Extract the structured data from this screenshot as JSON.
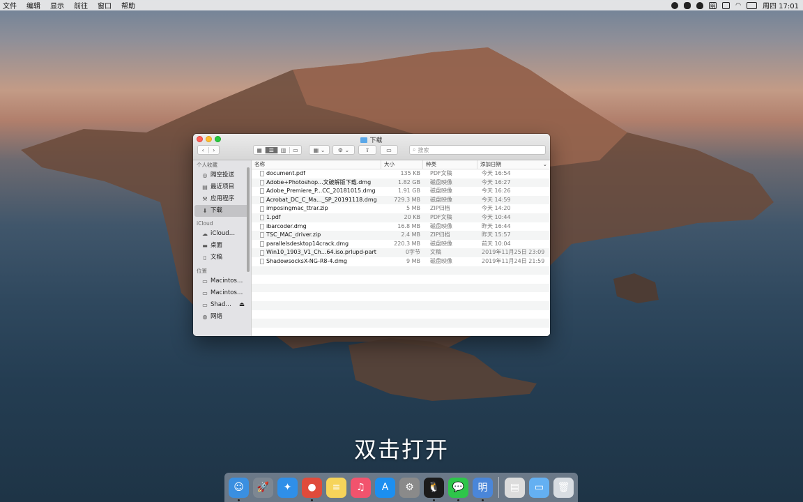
{
  "menubar": {
    "menus": [
      "文件",
      "编辑",
      "显示",
      "前往",
      "窗口",
      "帮助"
    ],
    "status_icons": [
      "record-icon",
      "wechat-icon",
      "qq-icon",
      "ming-icon",
      "keyboard-icon",
      "wifi-icon",
      "battery-icon"
    ],
    "ime_label": "明",
    "clock": "周四 17:01"
  },
  "window": {
    "title": "下载",
    "search_placeholder": "搜索"
  },
  "sidebar": {
    "sections": [
      {
        "header": "个人收藏",
        "items": [
          {
            "label": "隔空投送",
            "icon": "airdrop-icon"
          },
          {
            "label": "最近项目",
            "icon": "recents-icon"
          },
          {
            "label": "应用程序",
            "icon": "applications-icon"
          },
          {
            "label": "下载",
            "icon": "downloads-icon",
            "active": true
          }
        ]
      },
      {
        "header": "iCloud",
        "items": [
          {
            "label": "iCloud…",
            "icon": "cloud-icon"
          },
          {
            "label": "桌面",
            "icon": "desktop-icon"
          },
          {
            "label": "文稿",
            "icon": "documents-icon"
          }
        ]
      },
      {
        "header": "位置",
        "items": [
          {
            "label": "Macintos…",
            "icon": "disk-icon"
          },
          {
            "label": "Macintos…",
            "icon": "disk-icon"
          },
          {
            "label": "Shad…",
            "icon": "disk-icon",
            "eject": "⏏"
          },
          {
            "label": "网络",
            "icon": "network-icon"
          }
        ]
      }
    ]
  },
  "columns": {
    "name": "名称",
    "size": "大小",
    "kind": "种类",
    "date": "添加日期"
  },
  "files": [
    {
      "name": "document.pdf",
      "size": "135 KB",
      "kind": "PDF文稿",
      "date": "今天 16:54"
    },
    {
      "name": "Adobe+Photoshop...文破解版下载.dmg",
      "size": "1.82 GB",
      "kind": "磁盘映像",
      "date": "今天 16:27"
    },
    {
      "name": "Adobe_Premiere_P...CC_20181015.dmg",
      "size": "1.91 GB",
      "kind": "磁盘映像",
      "date": "今天 16:26"
    },
    {
      "name": "Acrobat_DC_C_Ma..._SP_20191118.dmg",
      "size": "729.3 MB",
      "kind": "磁盘映像",
      "date": "今天 14:59"
    },
    {
      "name": "imposingmac_ttrar.zip",
      "size": "5 MB",
      "kind": "ZIP归档",
      "date": "今天 14:20"
    },
    {
      "name": "1.pdf",
      "size": "20 KB",
      "kind": "PDF文稿",
      "date": "今天 10:44"
    },
    {
      "name": "ibarcoder.dmg",
      "size": "16.8 MB",
      "kind": "磁盘映像",
      "date": "昨天 16:44"
    },
    {
      "name": "TSC_MAC_driver.zip",
      "size": "2.4 MB",
      "kind": "ZIP归档",
      "date": "昨天 15:57"
    },
    {
      "name": "parallelsdesktop14crack.dmg",
      "size": "220.3 MB",
      "kind": "磁盘映像",
      "date": "前天 10:04"
    },
    {
      "name": "Win10_1903_V1_Ch...64.iso.prlupd-part",
      "size": "0字节",
      "kind": "文稿",
      "date": "2019年11月25日 23:09"
    },
    {
      "name": "ShadowsocksX-NG-R8-4.dmg",
      "size": "9 MB",
      "kind": "磁盘映像",
      "date": "2019年11月24日 21:59"
    }
  ],
  "subtitle": "双击打开",
  "dock": {
    "apps": [
      {
        "name": "finder",
        "color": "#3a8fe0",
        "glyph": "☺",
        "running": true
      },
      {
        "name": "launchpad",
        "color": "#7d8792",
        "glyph": "🚀",
        "running": false
      },
      {
        "name": "safari",
        "color": "#2f8fe8",
        "glyph": "✦",
        "running": false
      },
      {
        "name": "chrome",
        "color": "#e04b3b",
        "glyph": "●",
        "running": true
      },
      {
        "name": "notes",
        "color": "#f6d45a",
        "glyph": "≡",
        "running": false
      },
      {
        "name": "music",
        "color": "#f2536d",
        "glyph": "♫",
        "running": false
      },
      {
        "name": "app-store",
        "color": "#1c8ff0",
        "glyph": "A",
        "running": false
      },
      {
        "name": "system-preferences",
        "color": "#8a8a8a",
        "glyph": "⚙",
        "running": false
      },
      {
        "name": "qq",
        "color": "#1b1b1b",
        "glyph": "🐧",
        "running": true
      },
      {
        "name": "wechat",
        "color": "#2ec54a",
        "glyph": "💬",
        "running": true
      },
      {
        "name": "ming-ime",
        "color": "#4a86d9",
        "glyph": "明",
        "running": true
      }
    ],
    "stacks": [
      {
        "name": "preview",
        "color": "#dcdcdc",
        "glyph": "▤"
      },
      {
        "name": "downloads-folder",
        "color": "#64b0f2",
        "glyph": "▭"
      },
      {
        "name": "trash",
        "color": "#d8dde2",
        "glyph": "🗑"
      }
    ]
  }
}
